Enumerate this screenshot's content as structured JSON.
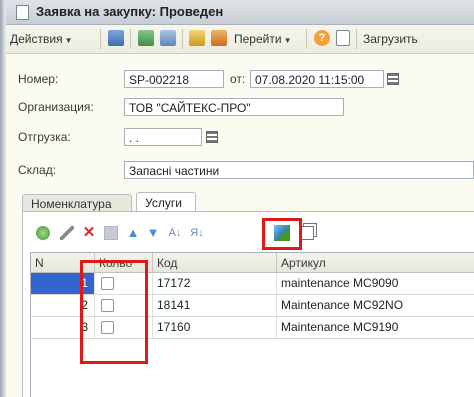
{
  "window": {
    "title": "Заявка на закупку: Проведен"
  },
  "toolbar": {
    "actions_label": "Действия",
    "goto_label": "Перейти",
    "help_label": "?",
    "load_label": "Загрузить"
  },
  "form": {
    "number_label": "Номер:",
    "number_value": "SP-002218",
    "date_label": "от:",
    "date_value": "07.08.2020 11:15:00",
    "org_label": "Организация:",
    "org_value": "ТОВ \"САЙТЕКС-ПРО\"",
    "shipment_label": "Отгрузка:",
    "shipment_value": " .  .",
    "warehouse_label": "Склад:",
    "warehouse_value": "Запасні частини"
  },
  "tabs": [
    {
      "label": "Номенклатура",
      "active": false
    },
    {
      "label": "Услуги",
      "active": true
    }
  ],
  "grid": {
    "columns": [
      "N",
      "Колво",
      "Код",
      "Артикул"
    ],
    "rows": [
      {
        "n": "1",
        "code": "17172",
        "article": "maintenance MC9090"
      },
      {
        "n": "2",
        "code": "18141",
        "article": "Maintenance MC92NO"
      },
      {
        "n": "3",
        "code": "17160",
        "article": "Maintenance MC9190"
      }
    ]
  },
  "colors": {
    "highlight": "#e01818",
    "row_selected": "#3366cc"
  }
}
